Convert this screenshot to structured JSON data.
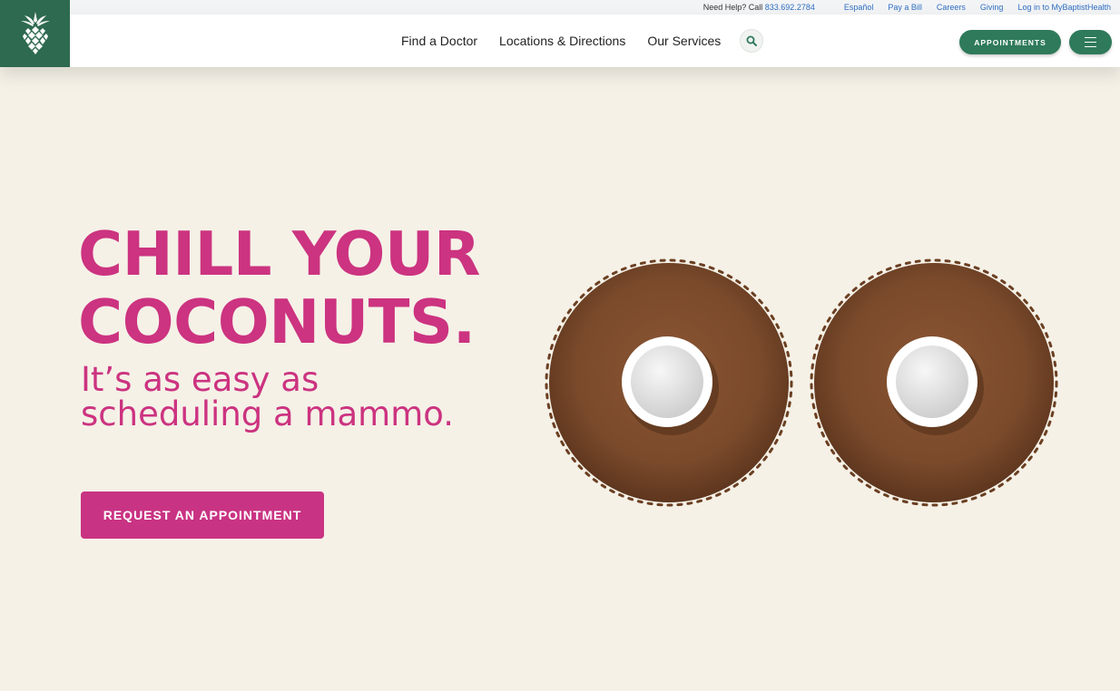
{
  "utility_bar": {
    "help_prefix": "Need Help? Call",
    "phone": "833.692.2784",
    "links": [
      "Español",
      "Pay a Bill",
      "Careers",
      "Giving",
      "Log in to MyBaptistHealth"
    ]
  },
  "header": {
    "logo_icon": "pineapple-icon",
    "nav": [
      "Find a Doctor",
      "Locations & Directions",
      "Our Services"
    ],
    "search_icon": "search-icon",
    "appointments_label": "APPOINTMENTS",
    "menu_icon": "hamburger-menu-icon"
  },
  "hero": {
    "headline_line1": "CHILL YOUR",
    "headline_line2": "COCONUTS.",
    "subhead_line1": "It’s as easy as",
    "subhead_line2": "scheduling a mammo.",
    "cta_label": "REQUEST AN APPOINTMENT"
  },
  "colors": {
    "brand_green": "#2e6a4f",
    "button_green": "#2e7a5a",
    "accent_pink": "#cc3380",
    "background": "#f5f1e7"
  }
}
